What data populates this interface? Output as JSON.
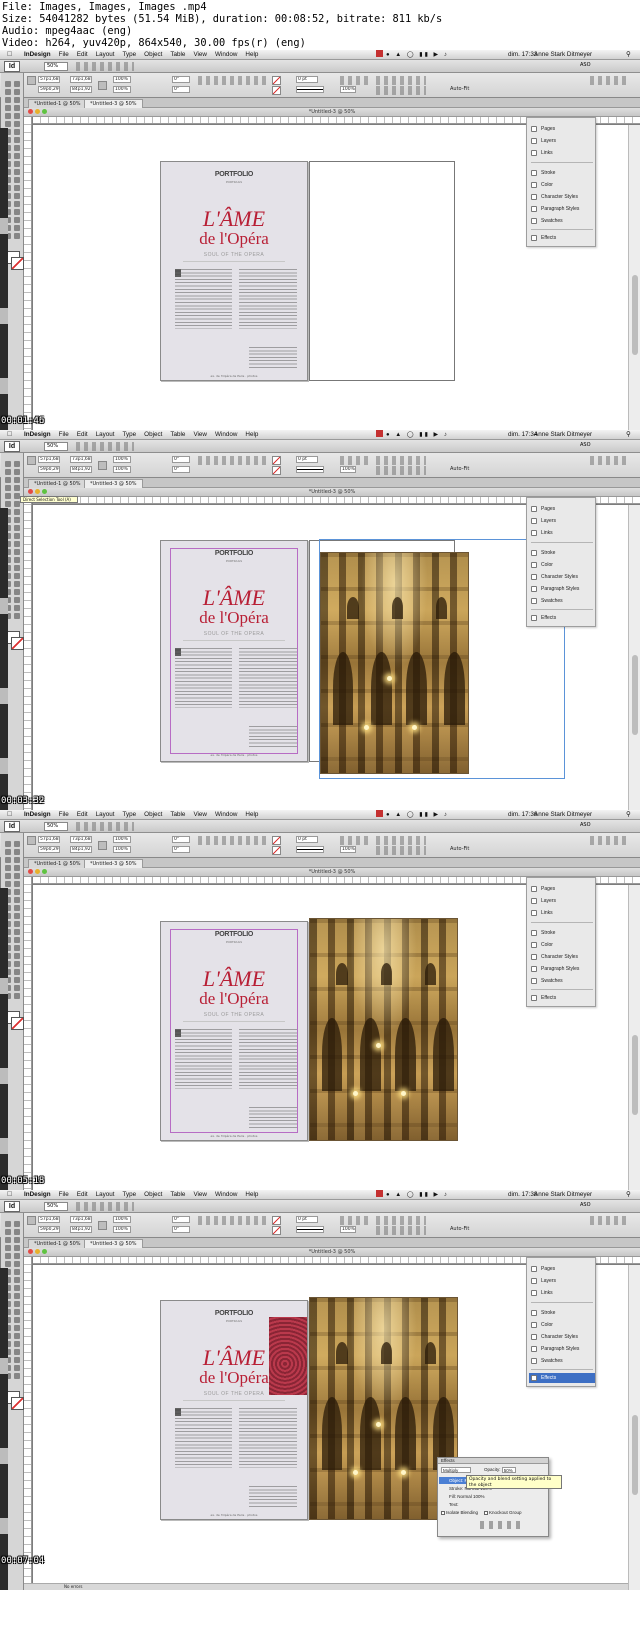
{
  "header": {
    "line1": "File: Images, Images, Images .mp4",
    "line2": "Size: 54041282 bytes (51.54 MiB), duration: 00:08:52, bitrate: 811 kb/s",
    "line3": "Audio: mpeg4aac (eng)",
    "line4": "Video: h264, yuv420p, 864x540, 30.00 fps(r) (eng)"
  },
  "menubar": {
    "app_name": "InDesign",
    "items": [
      "File",
      "Edit",
      "Layout",
      "Type",
      "Object",
      "Table",
      "View",
      "Window",
      "Help"
    ],
    "user": "Anne Stark Ditmeyer"
  },
  "appbar": {
    "logo": "Id",
    "zoom": "50%",
    "workspace": "ASO"
  },
  "control": {
    "x1": "57p1,68",
    "y1": "59p0,29",
    "w1": "73p1,68",
    "h1": "84p1,92",
    "scale_x": "100%",
    "scale_y": "100%",
    "rotate": "0°",
    "shear": "0°",
    "stroke_weight": "0 pt",
    "opacity": "100%",
    "fit": "Auto-Fit"
  },
  "document": {
    "tab1": "*Untitled-1 @ 50%",
    "tab2": "*Untitled-3 @ 50%",
    "window_title": "*Untitled-3 @ 50%",
    "status": "No errors"
  },
  "spread": {
    "portfolio": "PORTFOLIO",
    "portfolio_sub": "PORTRAILS",
    "title_line1": "L'ÂME",
    "title_line2": "de l'Opéra",
    "subtitle": "SOUL OF THE OPERA",
    "footnote": "ex. de l'Opéra de Paris · photos"
  },
  "panels": {
    "items": [
      "Pages",
      "Layers",
      "Links",
      "Stroke",
      "Color",
      "Character Styles",
      "Paragraph Styles",
      "Swatches",
      "Effects"
    ]
  },
  "frames": [
    {
      "timestamp": "00:01:46",
      "clock": "dim. 17:33"
    },
    {
      "timestamp": "00:03:32",
      "clock": "dim. 17:34",
      "tooltip": "Direct Selection Tool (A)"
    },
    {
      "timestamp": "00:05:18",
      "clock": "dim. 17:36"
    },
    {
      "timestamp": "00:07:04",
      "clock": "dim. 17:38"
    }
  ],
  "effects_panel": {
    "title": "Effects",
    "blend_mode": "Multiply",
    "opacity_label": "Opacity:",
    "opacity_value": "50%",
    "rows": [
      "Object: Multiply 50%",
      "Stroke: Normal 100%",
      "Fill: Normal 100%",
      "Text:"
    ],
    "tooltip": "Opacity and blend setting applied to the object",
    "isolate_label": "Isolate Blending",
    "knockout_label": "Knockout Group"
  }
}
